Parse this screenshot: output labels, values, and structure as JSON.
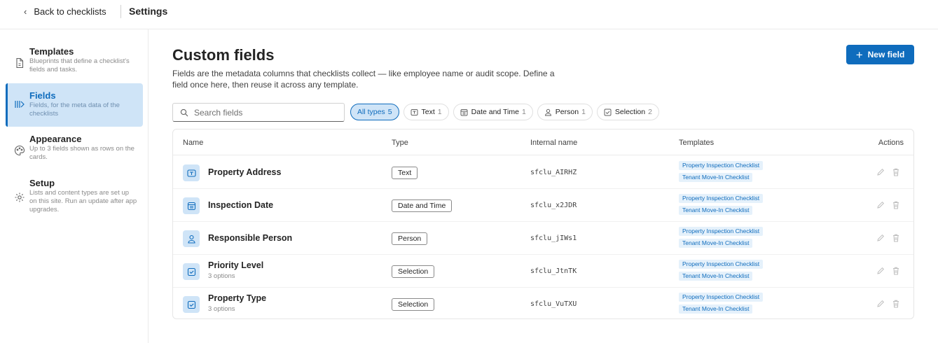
{
  "header": {
    "back_label": "Back to checklists",
    "title": "Settings"
  },
  "sidebar": {
    "items": [
      {
        "title": "Templates",
        "desc": "Blueprints that define a checklist's fields and tasks.",
        "icon": "document-icon"
      },
      {
        "title": "Fields",
        "desc": "Fields, for the meta data of the checklists",
        "icon": "fields-icon",
        "active": true
      },
      {
        "title": "Appearance",
        "desc": "Up to 3 fields shown as rows on the cards.",
        "icon": "palette-icon"
      },
      {
        "title": "Setup",
        "desc": "Lists and content types are set up on this site. Run an update after app upgrades.",
        "icon": "gear-icon"
      }
    ]
  },
  "main": {
    "title": "Custom fields",
    "description": "Fields are the metadata columns that checklists collect — like employee name or audit scope. Define a field once here, then reuse it across any template.",
    "new_button": "New field",
    "search_placeholder": "Search fields",
    "filters": [
      {
        "label": "All types",
        "count": "5",
        "active": true
      },
      {
        "label": "Text",
        "count": "1",
        "icon": "text-icon"
      },
      {
        "label": "Date and Time",
        "count": "1",
        "icon": "calendar-icon"
      },
      {
        "label": "Person",
        "count": "1",
        "icon": "person-icon"
      },
      {
        "label": "Selection",
        "count": "2",
        "icon": "checkbox-icon"
      }
    ],
    "table": {
      "columns": {
        "name": "Name",
        "type": "Type",
        "internal": "Internal name",
        "templates": "Templates",
        "actions": "Actions"
      },
      "rows": [
        {
          "name": "Property Address",
          "sub": "",
          "type": "Text",
          "internal": "sfclu_AIRHZ",
          "templates": [
            "Property Inspection Checklist",
            "Tenant Move-In Checklist"
          ],
          "icon": "text-icon"
        },
        {
          "name": "Inspection Date",
          "sub": "",
          "type": "Date and Time",
          "internal": "sfclu_x2JDR",
          "templates": [
            "Property Inspection Checklist",
            "Tenant Move-In Checklist"
          ],
          "icon": "calendar-icon"
        },
        {
          "name": "Responsible Person",
          "sub": "",
          "type": "Person",
          "internal": "sfclu_jIWs1",
          "templates": [
            "Property Inspection Checklist",
            "Tenant Move-In Checklist"
          ],
          "icon": "person-icon"
        },
        {
          "name": "Priority Level",
          "sub": "3 options",
          "type": "Selection",
          "internal": "sfclu_JtnTK",
          "templates": [
            "Property Inspection Checklist",
            "Tenant Move-In Checklist"
          ],
          "icon": "checkbox-icon"
        },
        {
          "name": "Property Type",
          "sub": "3 options",
          "type": "Selection",
          "internal": "sfclu_VuTXU",
          "templates": [
            "Property Inspection Checklist",
            "Tenant Move-In Checklist"
          ],
          "icon": "checkbox-icon"
        }
      ]
    }
  },
  "colors": {
    "accent": "#0f6cbd",
    "accent_light": "#cfe4f7"
  }
}
